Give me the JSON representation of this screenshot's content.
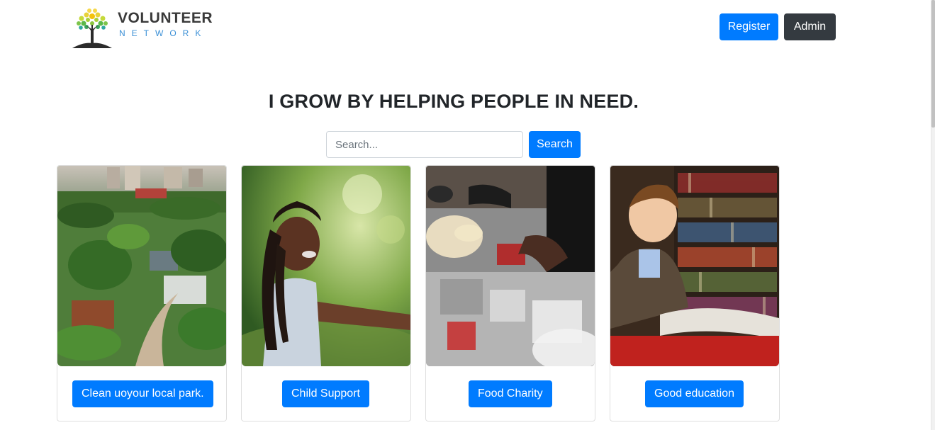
{
  "brand": {
    "title": "VOLUNTEER",
    "subtitle": "NETWORK",
    "icon": "tree-logo-icon"
  },
  "nav": {
    "register_label": "Register",
    "admin_label": "Admin"
  },
  "hero": {
    "title": "I GROW BY HELPING PEOPLE IN NEED."
  },
  "search": {
    "placeholder": "Search...",
    "value": "",
    "button_label": "Search"
  },
  "events": [
    {
      "label": "Clean uoyour local park.",
      "image": "park-aerial-photo"
    },
    {
      "label": "Child Support",
      "image": "smiling-girl-photo"
    },
    {
      "label": "Food Charity",
      "image": "food-donation-photo"
    },
    {
      "label": "Good education",
      "image": "boy-reading-library-photo"
    }
  ],
  "colors": {
    "primary": "#007bff",
    "dark": "#343a40",
    "heading": "#212529",
    "brand_blue": "#3a8fd6"
  }
}
